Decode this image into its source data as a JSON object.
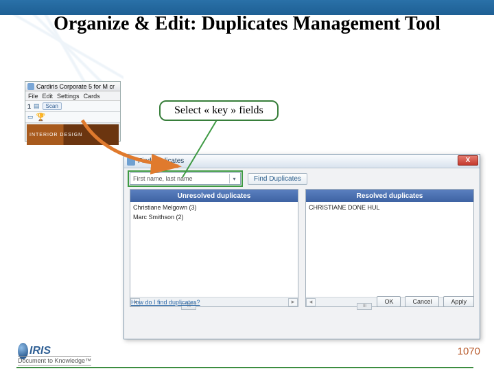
{
  "slide": {
    "title": "Organize & Edit: Duplicates Management Tool",
    "callout": "Select « key » fields",
    "page_number": "1070"
  },
  "thumb": {
    "window_title": "Cardiris Corporate 5 for M cr",
    "menu": [
      "File",
      "Edit",
      "Settings",
      "Cards"
    ],
    "step_number": "1",
    "scan_label": "Scan",
    "card_caption": "INTERIOR DESIGN"
  },
  "dialog": {
    "title": "Find duplicates",
    "combo_value": "First name, last name",
    "find_button": "Find Duplicates",
    "pane_left_header": "Unresolved duplicates",
    "pane_right_header": "Resolved duplicates",
    "unresolved": [
      "Christiane Melgown (3)",
      "Marc Smithson (2)"
    ],
    "resolved": [
      "CHRISTIANE DONE  HUL"
    ],
    "scroll_label": "III",
    "help_link": "How do I find duplicates?",
    "buttons": {
      "ok": "OK",
      "cancel": "Cancel",
      "apply": "Apply"
    },
    "close": "X"
  },
  "footer": {
    "brand": "IRIS",
    "tagline": "Document to Knowledge™"
  }
}
